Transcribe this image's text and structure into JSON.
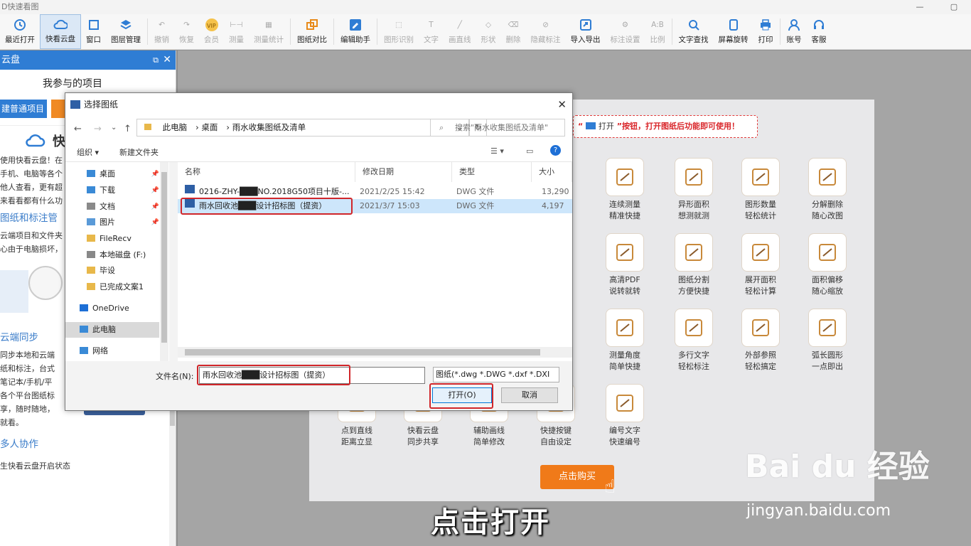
{
  "app": {
    "title": "D快速看图"
  },
  "toolbar": {
    "items": [
      {
        "label": "最近打开",
        "icon": "clock-icon"
      },
      {
        "label": "快看云盘",
        "icon": "cloud-icon"
      },
      {
        "label": "窗口",
        "icon": "window-icon"
      },
      {
        "label": "图层管理",
        "icon": "layers-icon"
      },
      {
        "label": "撤销",
        "icon": "undo-icon"
      },
      {
        "label": "恢复",
        "icon": "redo-icon"
      },
      {
        "label": "会员",
        "icon": "vip-icon"
      },
      {
        "label": "测量",
        "icon": "measure-icon"
      },
      {
        "label": "测量统计",
        "icon": "measure-stats-icon"
      },
      {
        "label": "图纸对比",
        "icon": "compare-icon"
      },
      {
        "label": "编辑助手",
        "icon": "edit-assistant-icon"
      },
      {
        "label": "图形识别",
        "icon": "shape-recognition-icon"
      },
      {
        "label": "文字",
        "icon": "text-icon"
      },
      {
        "label": "画直线",
        "icon": "line-icon"
      },
      {
        "label": "形状",
        "icon": "shape-icon"
      },
      {
        "label": "删除",
        "icon": "eraser-icon"
      },
      {
        "label": "隐藏标注",
        "icon": "hide-annotation-icon"
      },
      {
        "label": "导入导出",
        "icon": "import-export-icon"
      },
      {
        "label": "标注设置",
        "icon": "annotation-settings-icon"
      },
      {
        "label": "比例",
        "icon": "scale-icon"
      },
      {
        "label": "文字查找",
        "icon": "text-search-icon"
      },
      {
        "label": "屏幕旋转",
        "icon": "rotate-screen-icon"
      },
      {
        "label": "打印",
        "icon": "print-icon"
      },
      {
        "label": "账号",
        "icon": "account-icon"
      },
      {
        "label": "客服",
        "icon": "headset-icon"
      }
    ]
  },
  "left_panel": {
    "title": "云盘",
    "subtitle": "我参与的项目",
    "new_project_button": "建普通项目",
    "section1_title": "快",
    "lines1": [
      "使用快看云盘！在",
      "手机、电脑等各个",
      "他人查看，更有超",
      "来看看都有什么功"
    ],
    "section2_title": "图纸和标注管",
    "lines2": [
      "云端项目和文件夹",
      "心由于电脑损坏，"
    ],
    "section3_title": "云端同步",
    "lines3": [
      "同步本地和云端",
      "纸和标注，台式",
      "笔记本/手机/平",
      "各个平台图纸标",
      "享，随时随地，",
      "就看。"
    ],
    "section4_title": "多人协作",
    "footer": "生快看云盘开启状态"
  },
  "welcome": {
    "notice_prefix": "“",
    "notice_open": "打开",
    "notice_text": "”按钮，打开图纸后功能即可使用！",
    "features": [
      {
        "line1": "连续测量",
        "line2": "精准快捷",
        "icon": "continuous-measure-icon"
      },
      {
        "line1": "异形面积",
        "line2": "想测就测",
        "icon": "irregular-area-icon"
      },
      {
        "line1": "图形数量",
        "line2": "轻松统计",
        "icon": "shape-count-icon"
      },
      {
        "line1": "分解删除",
        "line2": "随心改图",
        "icon": "explode-delete-icon"
      },
      {
        "line1": "高清PDF",
        "line2": "说转就转",
        "icon": "pdf-icon"
      },
      {
        "line1": "图纸分割",
        "line2": "方便快捷",
        "icon": "split-drawing-icon"
      },
      {
        "line1": "展开面积",
        "line2": "轻松计算",
        "icon": "unfold-area-icon"
      },
      {
        "line1": "面积偏移",
        "line2": "随心缩放",
        "icon": "area-offset-icon"
      },
      {
        "line1": "测量角度",
        "line2": "简单快捷",
        "icon": "angle-measure-icon"
      },
      {
        "line1": "多行文字",
        "line2": "轻松标注",
        "icon": "multiline-text-icon"
      },
      {
        "line1": "外部参照",
        "line2": "轻松搞定",
        "icon": "dwg-xref-icon"
      },
      {
        "line1": "弧长圆形",
        "line2": "一点即出",
        "icon": "arc-length-icon"
      },
      {
        "line1": "点到直线",
        "line2": "距离立显",
        "icon": "point-line-icon"
      },
      {
        "line1": "快看云盘",
        "line2": "同步共享",
        "icon": "cloud-sync-icon"
      },
      {
        "line1": "辅助画线",
        "line2": "简单修改",
        "icon": "aux-line-icon"
      },
      {
        "line1": "快捷按键",
        "line2": "自由设定",
        "icon": "hotkey-icon"
      },
      {
        "line1": "编号文字",
        "line2": "快速编号",
        "icon": "numbered-text-icon"
      }
    ],
    "buy_button": "点击购买"
  },
  "dialog": {
    "title": "选择图纸",
    "breadcrumb": [
      "此电脑",
      "桌面",
      "雨水收集图纸及清单"
    ],
    "search_placeholder": "搜索\"雨水收集图纸及清单\"",
    "organize": "组织 ▾",
    "new_folder": "新建文件夹",
    "nav_items": [
      {
        "label": "桌面",
        "icon": "desktop-folder-icon",
        "pinned": true
      },
      {
        "label": "下载",
        "icon": "download-folder-icon",
        "pinned": true
      },
      {
        "label": "文档",
        "icon": "documents-folder-icon",
        "pinned": true
      },
      {
        "label": "图片",
        "icon": "pictures-folder-icon",
        "pinned": true
      },
      {
        "label": "FileRecv",
        "icon": "folder-icon",
        "pinned": false
      },
      {
        "label": "本地磁盘 (F:)",
        "icon": "drive-icon",
        "pinned": false
      },
      {
        "label": "毕设",
        "icon": "folder-icon",
        "pinned": false
      },
      {
        "label": "已完成文案1",
        "icon": "folder-icon",
        "pinned": false
      },
      {
        "label": "OneDrive",
        "icon": "onedrive-icon",
        "pinned": false
      },
      {
        "label": "此电脑",
        "icon": "this-pc-icon",
        "pinned": false
      },
      {
        "label": "网络",
        "icon": "network-icon",
        "pinned": false
      }
    ],
    "columns": [
      "名称",
      "修改日期",
      "类型",
      "大小"
    ],
    "files": [
      {
        "name": "0216-ZHY-███NO.2018G50项目十版-...",
        "date": "2021/2/25 15:42",
        "type": "DWG 文件",
        "size": "13,290"
      },
      {
        "name": "雨水回收池███设计招标图（提资）",
        "date": "2021/3/7 15:03",
        "type": "DWG 文件",
        "size": "4,197"
      }
    ],
    "filename_label": "文件名(N):",
    "filename_value": "雨水回收池███设计招标图（提资）",
    "filetype_value": "图纸(*.dwg *.DWG *.dxf *.DXI",
    "open_button": "打开(O)",
    "cancel_button": "取消"
  },
  "caption": "点击打开",
  "watermark": {
    "brand": "Bai du 经验",
    "url": "jingyan.baidu.com"
  },
  "colors": {
    "accent": "#2f7dd4",
    "highlight": "#d0262a",
    "orange": "#f07a19"
  }
}
